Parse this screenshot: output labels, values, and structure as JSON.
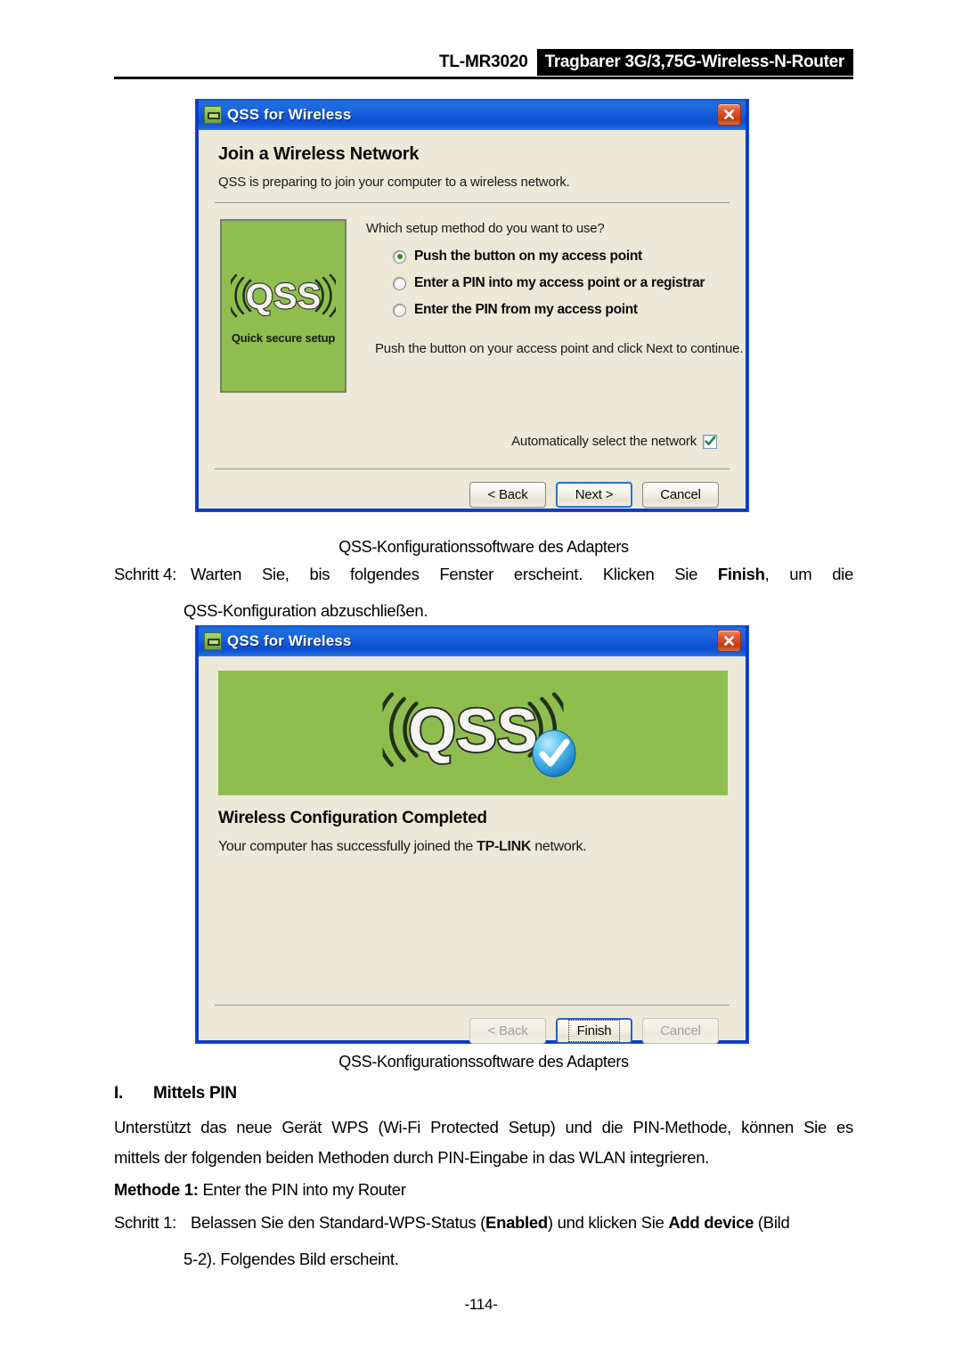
{
  "header": {
    "model": "TL-MR3020",
    "product": "Tragbarer 3G/3,75G-Wireless-N-Router"
  },
  "dialog1": {
    "title": "QSS for Wireless",
    "icon": "adapter-icon",
    "close_icon": "close-icon",
    "heading": "Join a Wireless Network",
    "subtext": "QSS is preparing to join your computer to a wireless network.",
    "logo": {
      "text": "QSS",
      "tagline": "Quick secure setup",
      "green": "#8FBE4F"
    },
    "question": "Which setup method do you want to use?",
    "options": [
      {
        "label": "Push the button on my access point",
        "checked": true
      },
      {
        "label": "Enter a PIN into my access point or a registrar",
        "checked": false
      },
      {
        "label": "Enter the PIN from my access point",
        "checked": false
      }
    ],
    "hint": "Push the button on your access point and click Next to continue.",
    "auto_select": {
      "label": "Automatically select the network",
      "checked": true
    },
    "buttons": [
      {
        "label": "< Back",
        "state": "normal"
      },
      {
        "label": "Next >",
        "state": "default"
      },
      {
        "label": "Cancel",
        "state": "normal"
      }
    ]
  },
  "dialog2": {
    "title": "QSS for Wireless",
    "icon": "adapter-icon",
    "close_icon": "close-icon",
    "logo": {
      "text": "QSS",
      "green": "#8FBE4F"
    },
    "badge_icon": "checkmark-badge-icon",
    "heading": "Wireless Configuration Completed",
    "sub_prefix": "Your computer has successfully joined the ",
    "sub_brand": "TP-LINK",
    "sub_suffix": " network.",
    "buttons": [
      {
        "label": "< Back",
        "state": "disabled"
      },
      {
        "label": "Finish",
        "state": "focused"
      },
      {
        "label": "Cancel",
        "state": "disabled"
      }
    ]
  },
  "caption1": "QSS-Konfigurationssoftware des Adapters",
  "caption2": "QSS-Konfigurationssoftware des Adapters",
  "step4": {
    "label": "Schritt 4:",
    "line1_a": "Warten Sie, bis folgendes Fenster erscheint. Klicken Sie ",
    "line1_bold": "Finish",
    "line1_b": ", um die",
    "line2": "QSS-Konfiguration abzuschließen."
  },
  "section": {
    "num": "I.",
    "title": "Mittels PIN"
  },
  "body": {
    "p1_line1": "Unterstützt das neue Gerät WPS (Wi-Fi Protected Setup) und die PIN-Methode, können Sie es",
    "p1_line2": "mittels der folgenden beiden Methoden durch PIN-Eingabe in das WLAN integrieren.",
    "method_bold": "Methode 1:",
    "method_rest": " Enter the PIN into my Router",
    "step1_label": "Schritt 1:",
    "step1_a": "Belassen Sie den Standard-WPS-Status (",
    "step1_bold1": "Enabled",
    "step1_b": ") und klicken Sie ",
    "step1_bold2": "Add device",
    "step1_c": " (Bild",
    "step1_line2": "5-2). Folgendes Bild erscheint."
  },
  "footer": {
    "page": "-114-"
  }
}
